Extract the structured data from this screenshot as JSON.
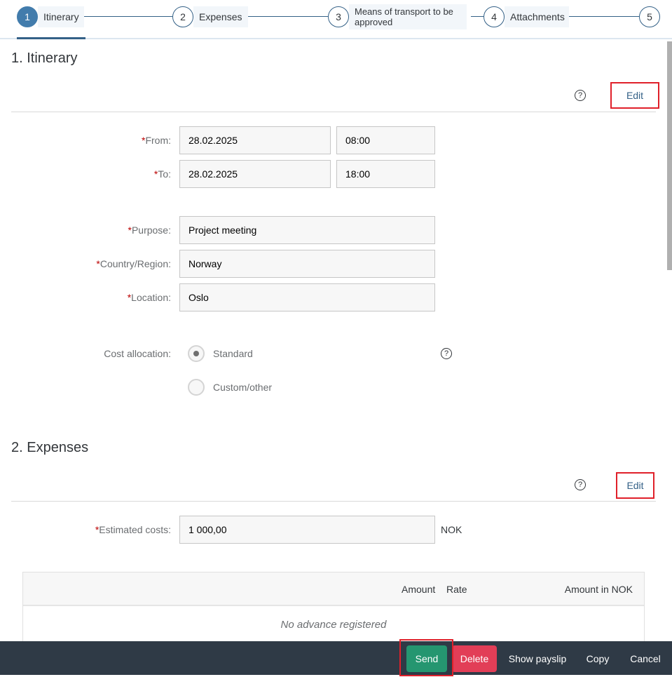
{
  "wizard": {
    "steps": [
      {
        "number": "1",
        "label": "Itinerary",
        "active": true
      },
      {
        "number": "2",
        "label": "Expenses",
        "active": false
      },
      {
        "number": "3",
        "label": "Means of transport to be approved",
        "active": false
      },
      {
        "number": "4",
        "label": "Attachments",
        "active": false
      },
      {
        "number": "5",
        "label": "",
        "active": false
      }
    ]
  },
  "itinerary": {
    "title": "1. Itinerary",
    "help_icon": "help-icon",
    "edit_label": "Edit",
    "from": {
      "required_mark": "*",
      "label": "From:",
      "date": "28.02.2025",
      "time": "08:00"
    },
    "to": {
      "required_mark": "*",
      "label": "To:",
      "date": "28.02.2025",
      "time": "18:00"
    },
    "purpose": {
      "required_mark": "*",
      "label": "Purpose:",
      "value": "Project meeting"
    },
    "country": {
      "required_mark": "*",
      "label": "Country/Region:",
      "value": "Norway"
    },
    "location": {
      "required_mark": "*",
      "label": "Location:",
      "value": "Oslo"
    },
    "cost_allocation": {
      "label": "Cost allocation:",
      "options": [
        {
          "label": "Standard",
          "selected": true
        },
        {
          "label": "Custom/other",
          "selected": false
        }
      ]
    }
  },
  "expenses": {
    "title": "2. Expenses",
    "edit_label": "Edit",
    "estimated_costs": {
      "required_mark": "*",
      "label": "Estimated costs:",
      "value": "1 000,00",
      "currency": "NOK"
    },
    "table": {
      "columns": [
        "Amount",
        "Rate",
        "Amount in NOK"
      ],
      "empty_text": "No advance registered"
    }
  },
  "footer": {
    "send": "Send",
    "delete": "Delete",
    "show_payslip": "Show payslip",
    "copy": "Copy",
    "cancel": "Cancel"
  },
  "colors": {
    "accent": "#427cac",
    "send": "#259670",
    "delete": "#e23e57",
    "footer_bg": "#2f3a46",
    "highlight": "#e0202a"
  }
}
